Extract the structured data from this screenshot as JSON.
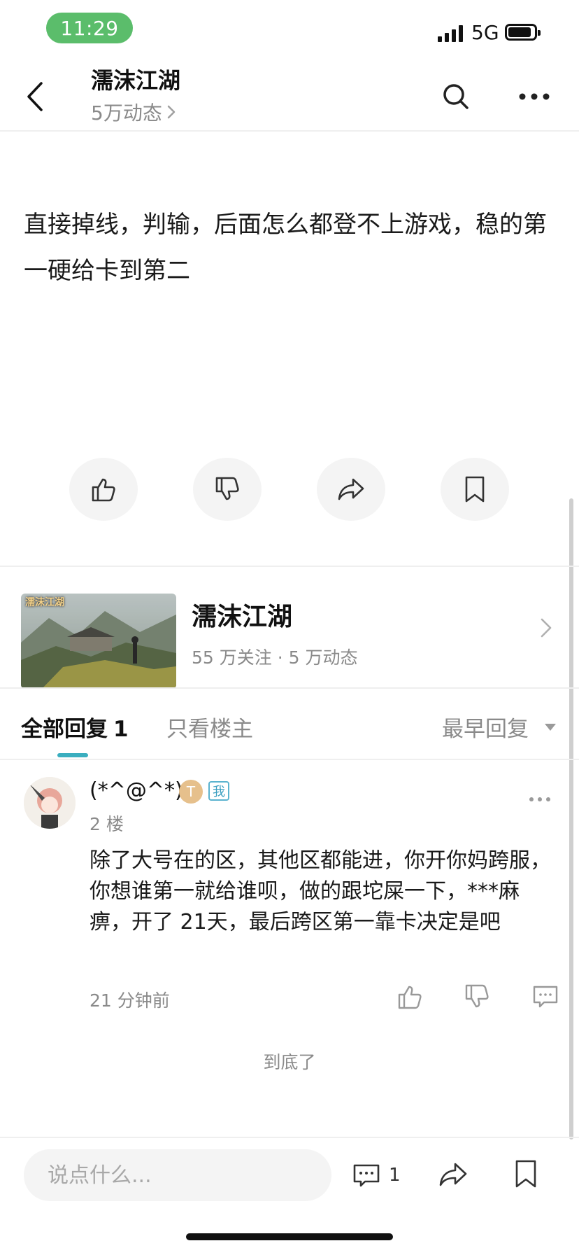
{
  "status_bar": {
    "time": "11:29",
    "network": "5G"
  },
  "header": {
    "title": "濡沫江湖",
    "subtitle": "5万动态"
  },
  "post": {
    "content": "直接掉线，判输，后面怎么都登不上游戏，稳的第一硬给卡到第二"
  },
  "post_actions": [
    "thumbs-up-icon",
    "thumbs-down-icon",
    "share-icon",
    "bookmark-icon"
  ],
  "game_card": {
    "name": "濡沫江湖",
    "stats": "55 万关注 · 5 万动态",
    "logo_text": "濡沫江湖"
  },
  "tabs": {
    "all_label": "全部回复",
    "all_count": "1",
    "host_only": "只看楼主",
    "sort": "最早回复"
  },
  "comment": {
    "username": "(*^@^*)",
    "level_badge": "T",
    "me_badge": "我",
    "floor": "2 楼",
    "text": "除了大号在的区，其他区都能进，你开你妈跨服，你想谁第一就给谁呗，做的跟坨屎一下，***麻痹，开了 21天，最后跨区第一靠卡决定是吧",
    "time": "21 分钟前"
  },
  "end_text": "到底了",
  "bottom_bar": {
    "placeholder": "说点什么...",
    "comment_count": "1"
  },
  "colors": {
    "time_pill": "#5bbd6b",
    "tab_accent": "#3aaebf",
    "muted_text": "#8a8a8a"
  }
}
